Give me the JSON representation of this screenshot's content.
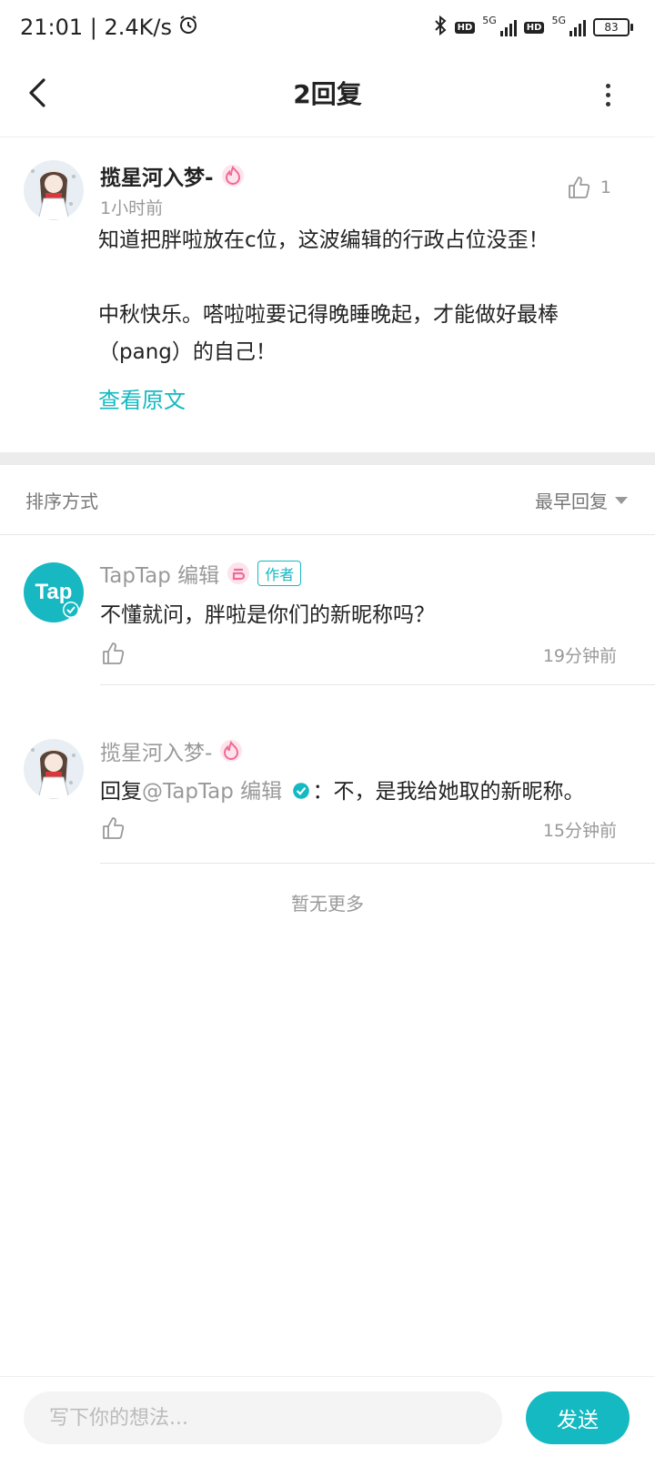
{
  "status_bar": {
    "time_speed": "21:01 | 2.4K/s",
    "hd1": "HD",
    "net1": "5G",
    "hd2": "HD",
    "net2": "5G",
    "battery": "83"
  },
  "header": {
    "title": "2回复"
  },
  "post": {
    "author": "揽星河入梦-",
    "time": "1小时前",
    "likes": "1",
    "line1": "知道把胖啦放在c位，这波编辑的行政占位没歪！",
    "line2": "中秋快乐。嗒啦啦要记得晚睡晚起，才能做好最棒",
    "line3": "（pang）的自己！",
    "view_original": "查看原文"
  },
  "sort": {
    "label": "排序方式",
    "value": "最早回复"
  },
  "replies": [
    {
      "author": "TapTap 编辑",
      "tag": "作者",
      "avatar_text": "Tap",
      "text": "不懂就问，胖啦是你们的新昵称吗？",
      "time": "19分钟前"
    },
    {
      "author": "揽星河入梦-",
      "reply_prefix": "回复",
      "mention": "@TapTap 编辑",
      "text": "：不，是我给她取的新昵称。",
      "time": "15分钟前"
    }
  ],
  "no_more": "暂无更多",
  "bottom": {
    "placeholder": "写下你的想法...",
    "send_label": "发送"
  },
  "colors": {
    "accent": "#15b9c1",
    "badge_pink": "#f06a95"
  }
}
